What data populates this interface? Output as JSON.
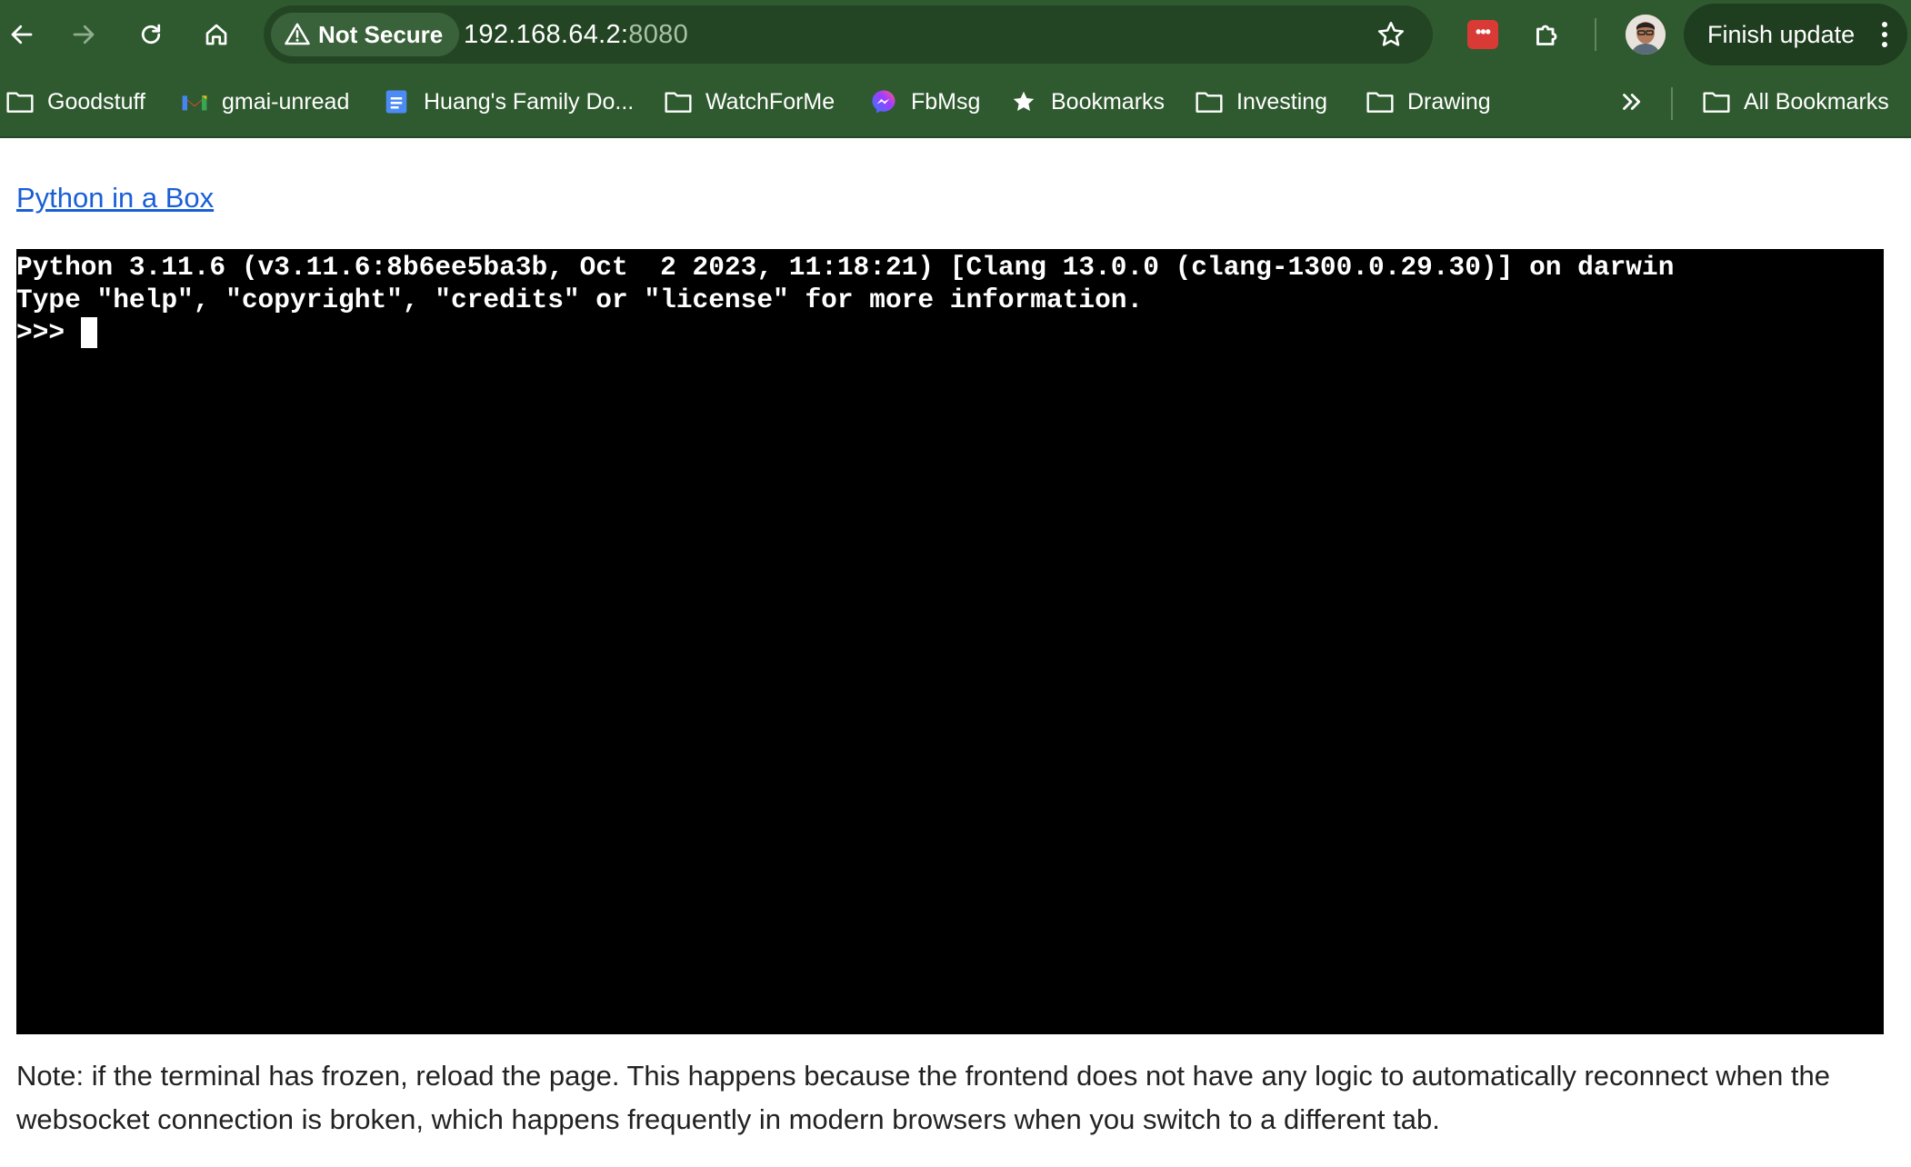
{
  "toolbar": {
    "security_label": "Not Secure",
    "url_host": "192.168.64.2:",
    "url_port": "8080",
    "finish_update_label": "Finish update"
  },
  "extension_badge": "•••",
  "bookmarks": [
    {
      "label": "Goodstuff",
      "icon": "folder-icon"
    },
    {
      "label": "gmai-unread",
      "icon": "gmail-icon"
    },
    {
      "label": "Huang's Family Do...",
      "icon": "google-docs-icon"
    },
    {
      "label": "WatchForMe",
      "icon": "folder-icon"
    },
    {
      "label": "FbMsg",
      "icon": "messenger-icon"
    },
    {
      "label": "Bookmarks",
      "icon": "star-icon"
    },
    {
      "label": "Investing",
      "icon": "folder-icon"
    },
    {
      "label": "Drawing",
      "icon": "folder-icon"
    },
    {
      "label": "All Bookmarks",
      "icon": "folder-icon"
    }
  ],
  "page": {
    "link_text": "Python in a Box",
    "terminal_lines": [
      "Python 3.11.6 (v3.11.6:8b6ee5ba3b, Oct  2 2023, 11:18:21) [Clang 13.0.0 (clang-1300.0.29.30)] on darwin",
      "Type \"help\", \"copyright\", \"credits\" or \"license\" for more information.",
      ">>> "
    ],
    "note": "Note: if the terminal has frozen, reload the page. This happens because the frontend does not have any logic to automatically reconnect when the websocket connection is broken, which happens frequently in modern browsers when you switch to a different tab."
  },
  "colors": {
    "chrome_green": "#2f5a2f",
    "omnibox": "#234523",
    "link_blue": "#1a5fd6",
    "terminal_bg": "#000000"
  }
}
